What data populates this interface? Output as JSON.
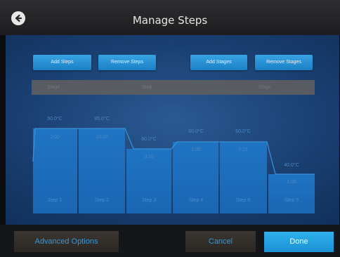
{
  "window": {
    "title": "Manage Steps"
  },
  "toolbar": {
    "add_steps": "Add Steps",
    "remove_steps": "Remove Steps",
    "add_stages": "Add Stages",
    "remove_stages": "Remove Stages"
  },
  "header": {
    "col1": "Stage",
    "col2": "Step",
    "col3": "Stage"
  },
  "steps": [
    {
      "name": "Step 1",
      "temp": "50.0°C",
      "time": "2:00"
    },
    {
      "name": "Step 2",
      "temp": "95.0°C",
      "time": "10:00"
    },
    {
      "name": "Step 3",
      "temp": "60.0°C",
      "time": "0:15"
    },
    {
      "name": "Step 4",
      "temp": "60.0°C",
      "time": "1:00"
    },
    {
      "name": "Step 5",
      "temp": "60.0°C",
      "time": "0:15"
    },
    {
      "name": "Step 6",
      "temp": "40.0°C",
      "time": "1:00"
    }
  ],
  "bottom": {
    "advanced": "Advanced Options",
    "cancel": "Cancel",
    "done": "Done"
  },
  "colors": {
    "accent": "#2f9ae0",
    "done_bg": "#1b90d6",
    "step_fill": "#1f74c3"
  },
  "icons": {
    "back": "back-arrow-icon"
  }
}
